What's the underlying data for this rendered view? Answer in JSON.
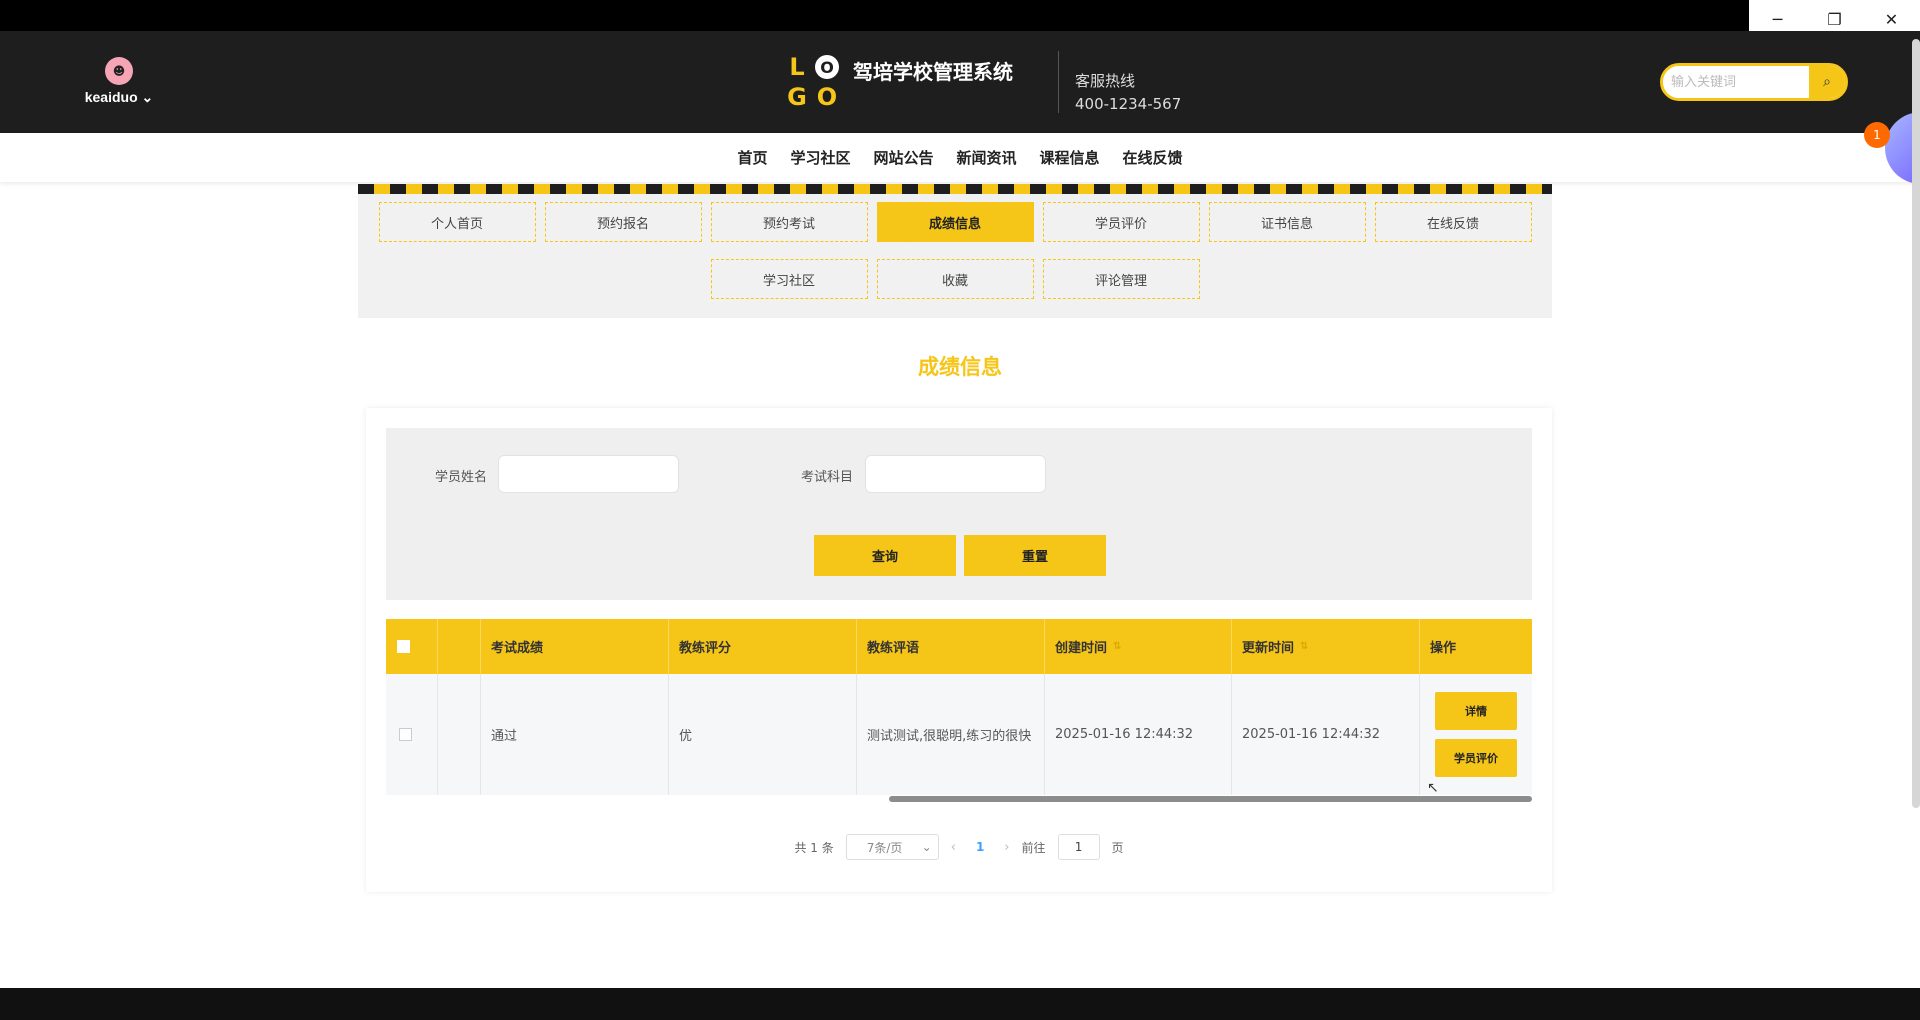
{
  "window": {
    "minimize": "─",
    "restore": "❐",
    "close": "✕"
  },
  "header": {
    "username": "keaiduo",
    "username_caret": "⌄",
    "avatar_glyph": "☻",
    "logo": [
      "L",
      "O",
      "G",
      "O"
    ],
    "site_title": "驾培学校管理系统",
    "hotline_label": "客服热线",
    "hotline_number": "400-1234-567",
    "search_placeholder": "输入关键词",
    "search_icon": "⌕"
  },
  "nav": [
    "首页",
    "学习社区",
    "网站公告",
    "新闻资讯",
    "课程信息",
    "在线反馈"
  ],
  "float_badge": "1",
  "menu": {
    "row1": [
      "个人首页",
      "预约报名",
      "预约考试",
      "成绩信息",
      "学员评价",
      "证书信息",
      "在线反馈"
    ],
    "row2": [
      "学习社区",
      "收藏",
      "评论管理"
    ],
    "active": "成绩信息"
  },
  "page_title": "成绩信息",
  "filters": {
    "student_name_label": "学员姓名",
    "student_name_value": "",
    "subject_label": "考试科目",
    "subject_value": "",
    "query_button": "查询",
    "reset_button": "重置"
  },
  "table": {
    "columns": [
      "考试成绩",
      "教练评分",
      "教练评语",
      "创建时间",
      "更新时间",
      "操作"
    ],
    "sort_icon": "⇅",
    "rows": [
      {
        "score": "通过",
        "coach_rating": "优",
        "coach_comment": "测试测试,很聪明,练习的很快",
        "created": "2025-01-16 12:44:32",
        "updated": "2025-01-16 12:44:32",
        "actions": [
          "详情",
          "学员评价"
        ]
      }
    ]
  },
  "pager": {
    "total": "共 1 条",
    "page_size": "7条/页",
    "prev": "‹",
    "current": "1",
    "next": "›",
    "goto_label": "前往",
    "goto_value": "1",
    "goto_suffix": "页"
  },
  "colors": {
    "accent": "#f5c518",
    "header_bg": "#1e1e1e"
  }
}
